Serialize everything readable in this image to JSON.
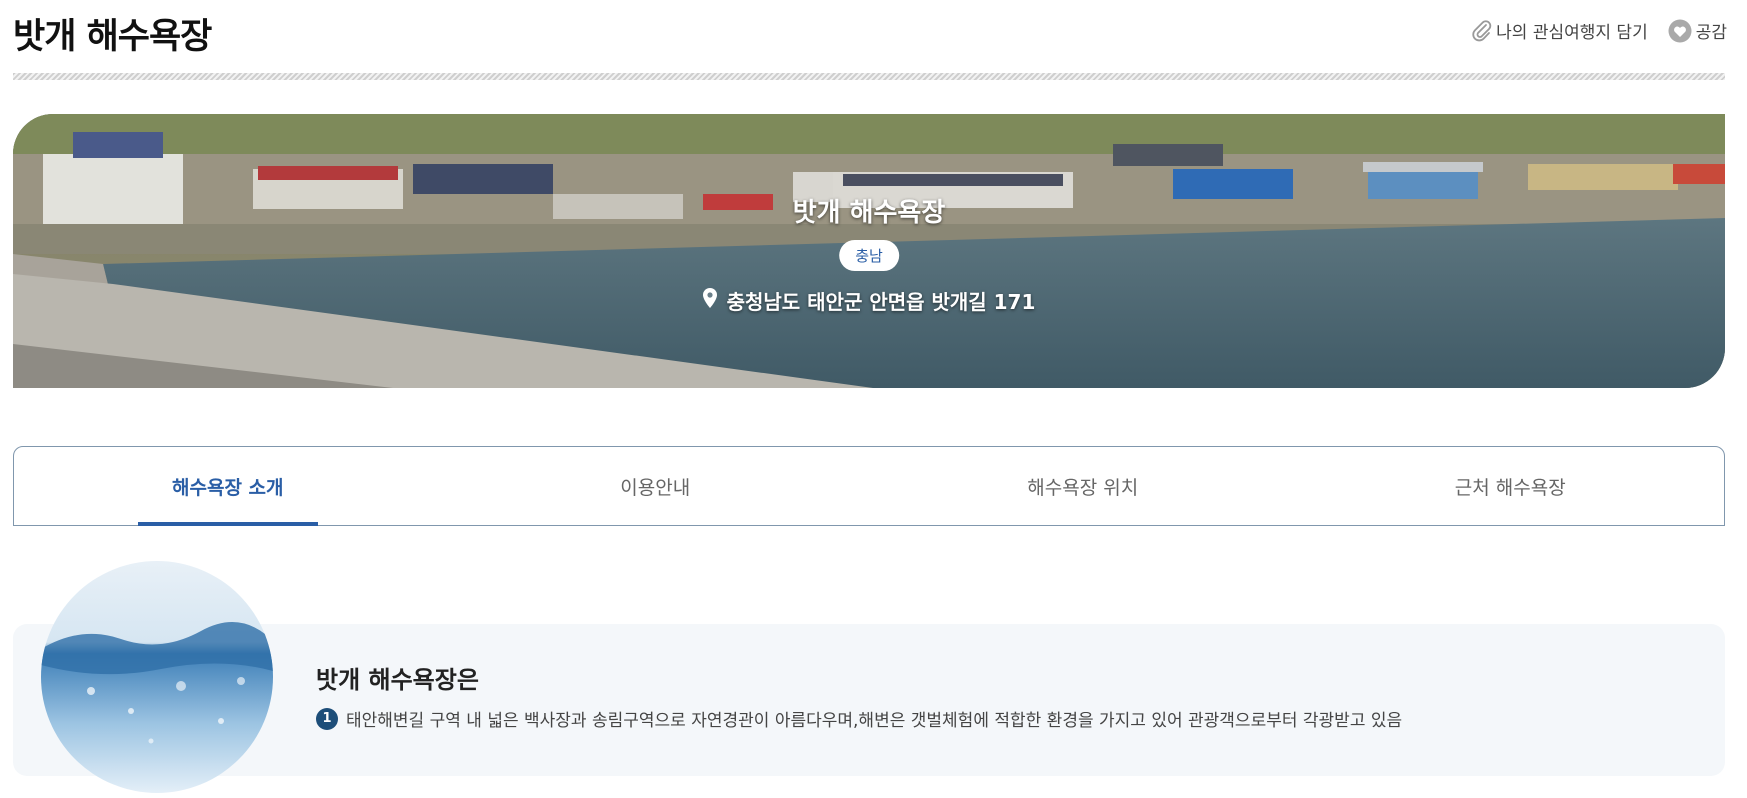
{
  "page": {
    "title": "밧개 해수욕장"
  },
  "actions": {
    "favorite_label": "나의 관심여행지 담기",
    "like_label": "공감"
  },
  "hero": {
    "title": "밧개 해수욕장",
    "region_badge": "충남",
    "address": "충청남도 태안군 안면읍 밧개길 171"
  },
  "tabs": [
    {
      "label": "해수욕장 소개",
      "active": true
    },
    {
      "label": "이용안내",
      "active": false
    },
    {
      "label": "해수욕장 위치",
      "active": false
    },
    {
      "label": "근처 해수욕장",
      "active": false
    }
  ],
  "intro": {
    "heading": "밧개 해수욕장은",
    "items": [
      {
        "number": "1",
        "text": "태안해변길 구역 내 넓은 백사장과 송림구역으로 자연경관이 아름다우며,해변은 갯벌체험에 적합한 환경을 가지고 있어 관광객으로부터 각광받고 있음"
      }
    ]
  },
  "colors": {
    "accent": "#2a5ea6",
    "tab_border": "#8097ad",
    "number_badge": "#1d4e79",
    "intro_bg": "#f4f7fa"
  },
  "icons": {
    "favorite": "paperclip-icon",
    "like": "heart-icon",
    "address": "location-pin-icon"
  }
}
